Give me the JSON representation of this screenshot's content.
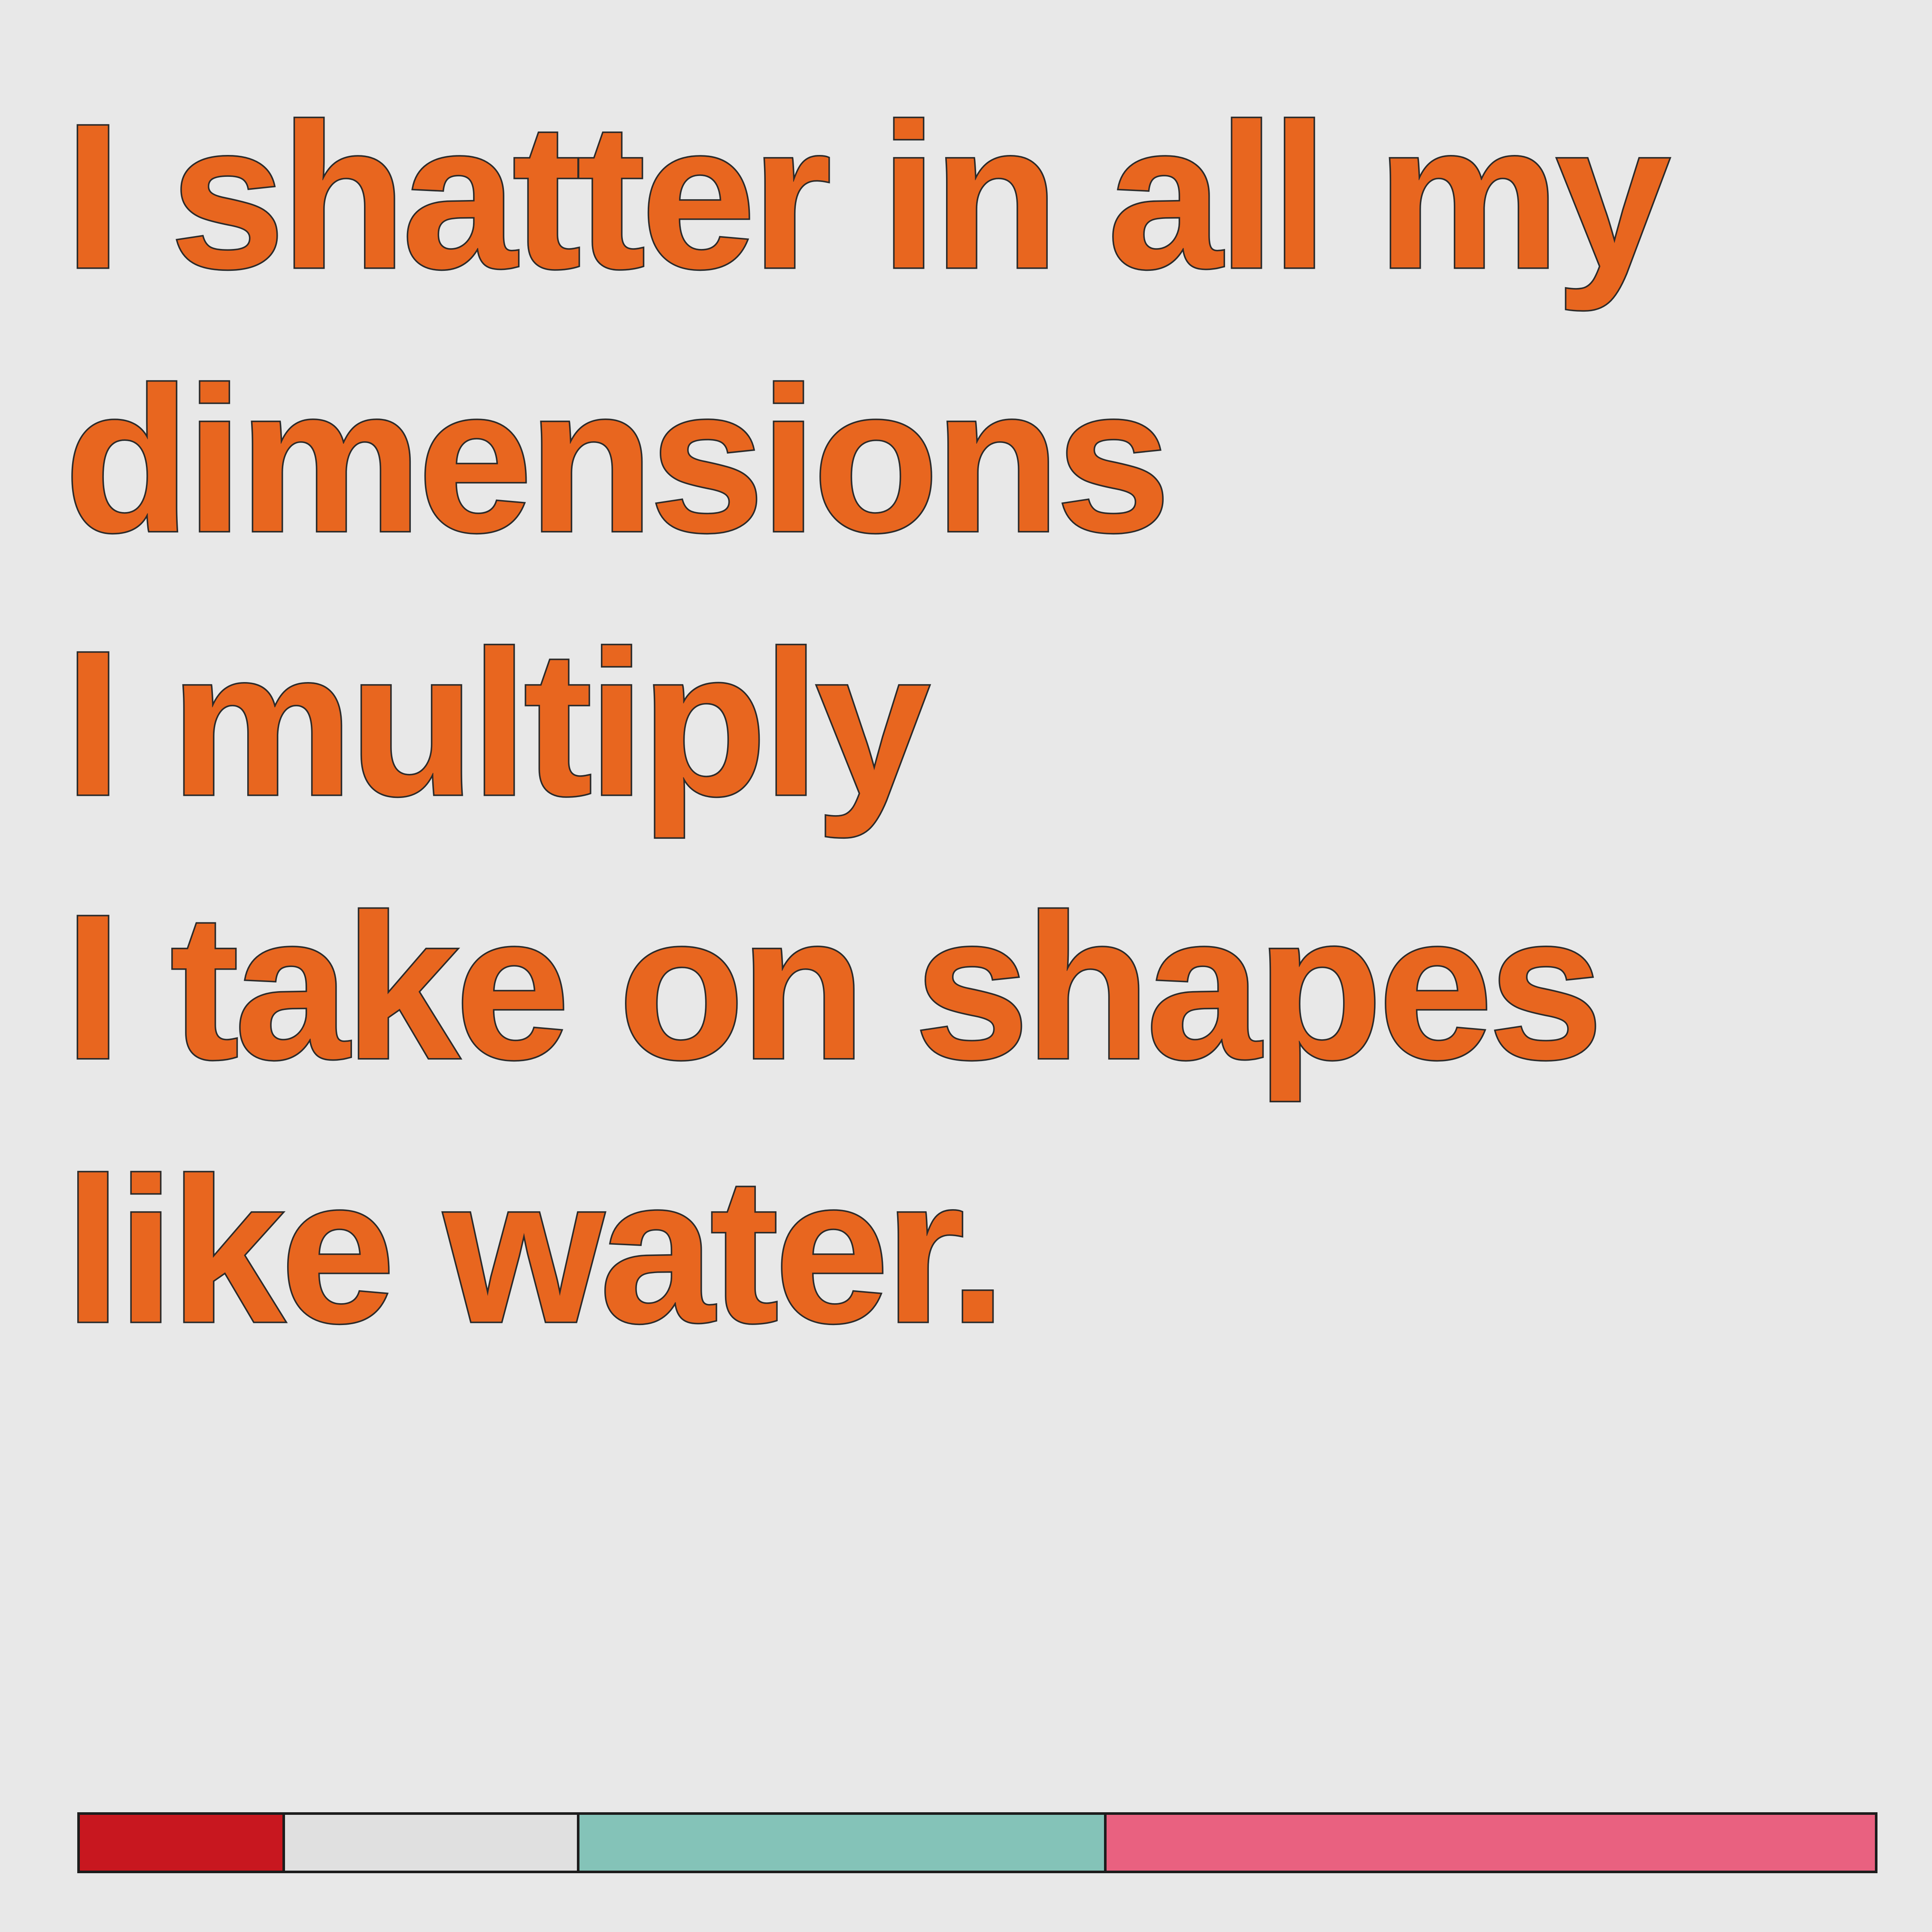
{
  "poem": {
    "lines": [
      "I shatter in all my",
      "dimensions",
      "I multiply",
      "I take on shapes",
      "like water."
    ],
    "text_color": "#e8661f",
    "outline_color": "#2a2a2a"
  },
  "background_color": "#e8e8e8",
  "color_bar": {
    "swatches": [
      {
        "name": "red",
        "color": "#c8171f"
      },
      {
        "name": "light-gray",
        "color": "#e0e0e0"
      },
      {
        "name": "teal",
        "color": "#84c3b8"
      },
      {
        "name": "pink",
        "color": "#e96180"
      }
    ]
  }
}
